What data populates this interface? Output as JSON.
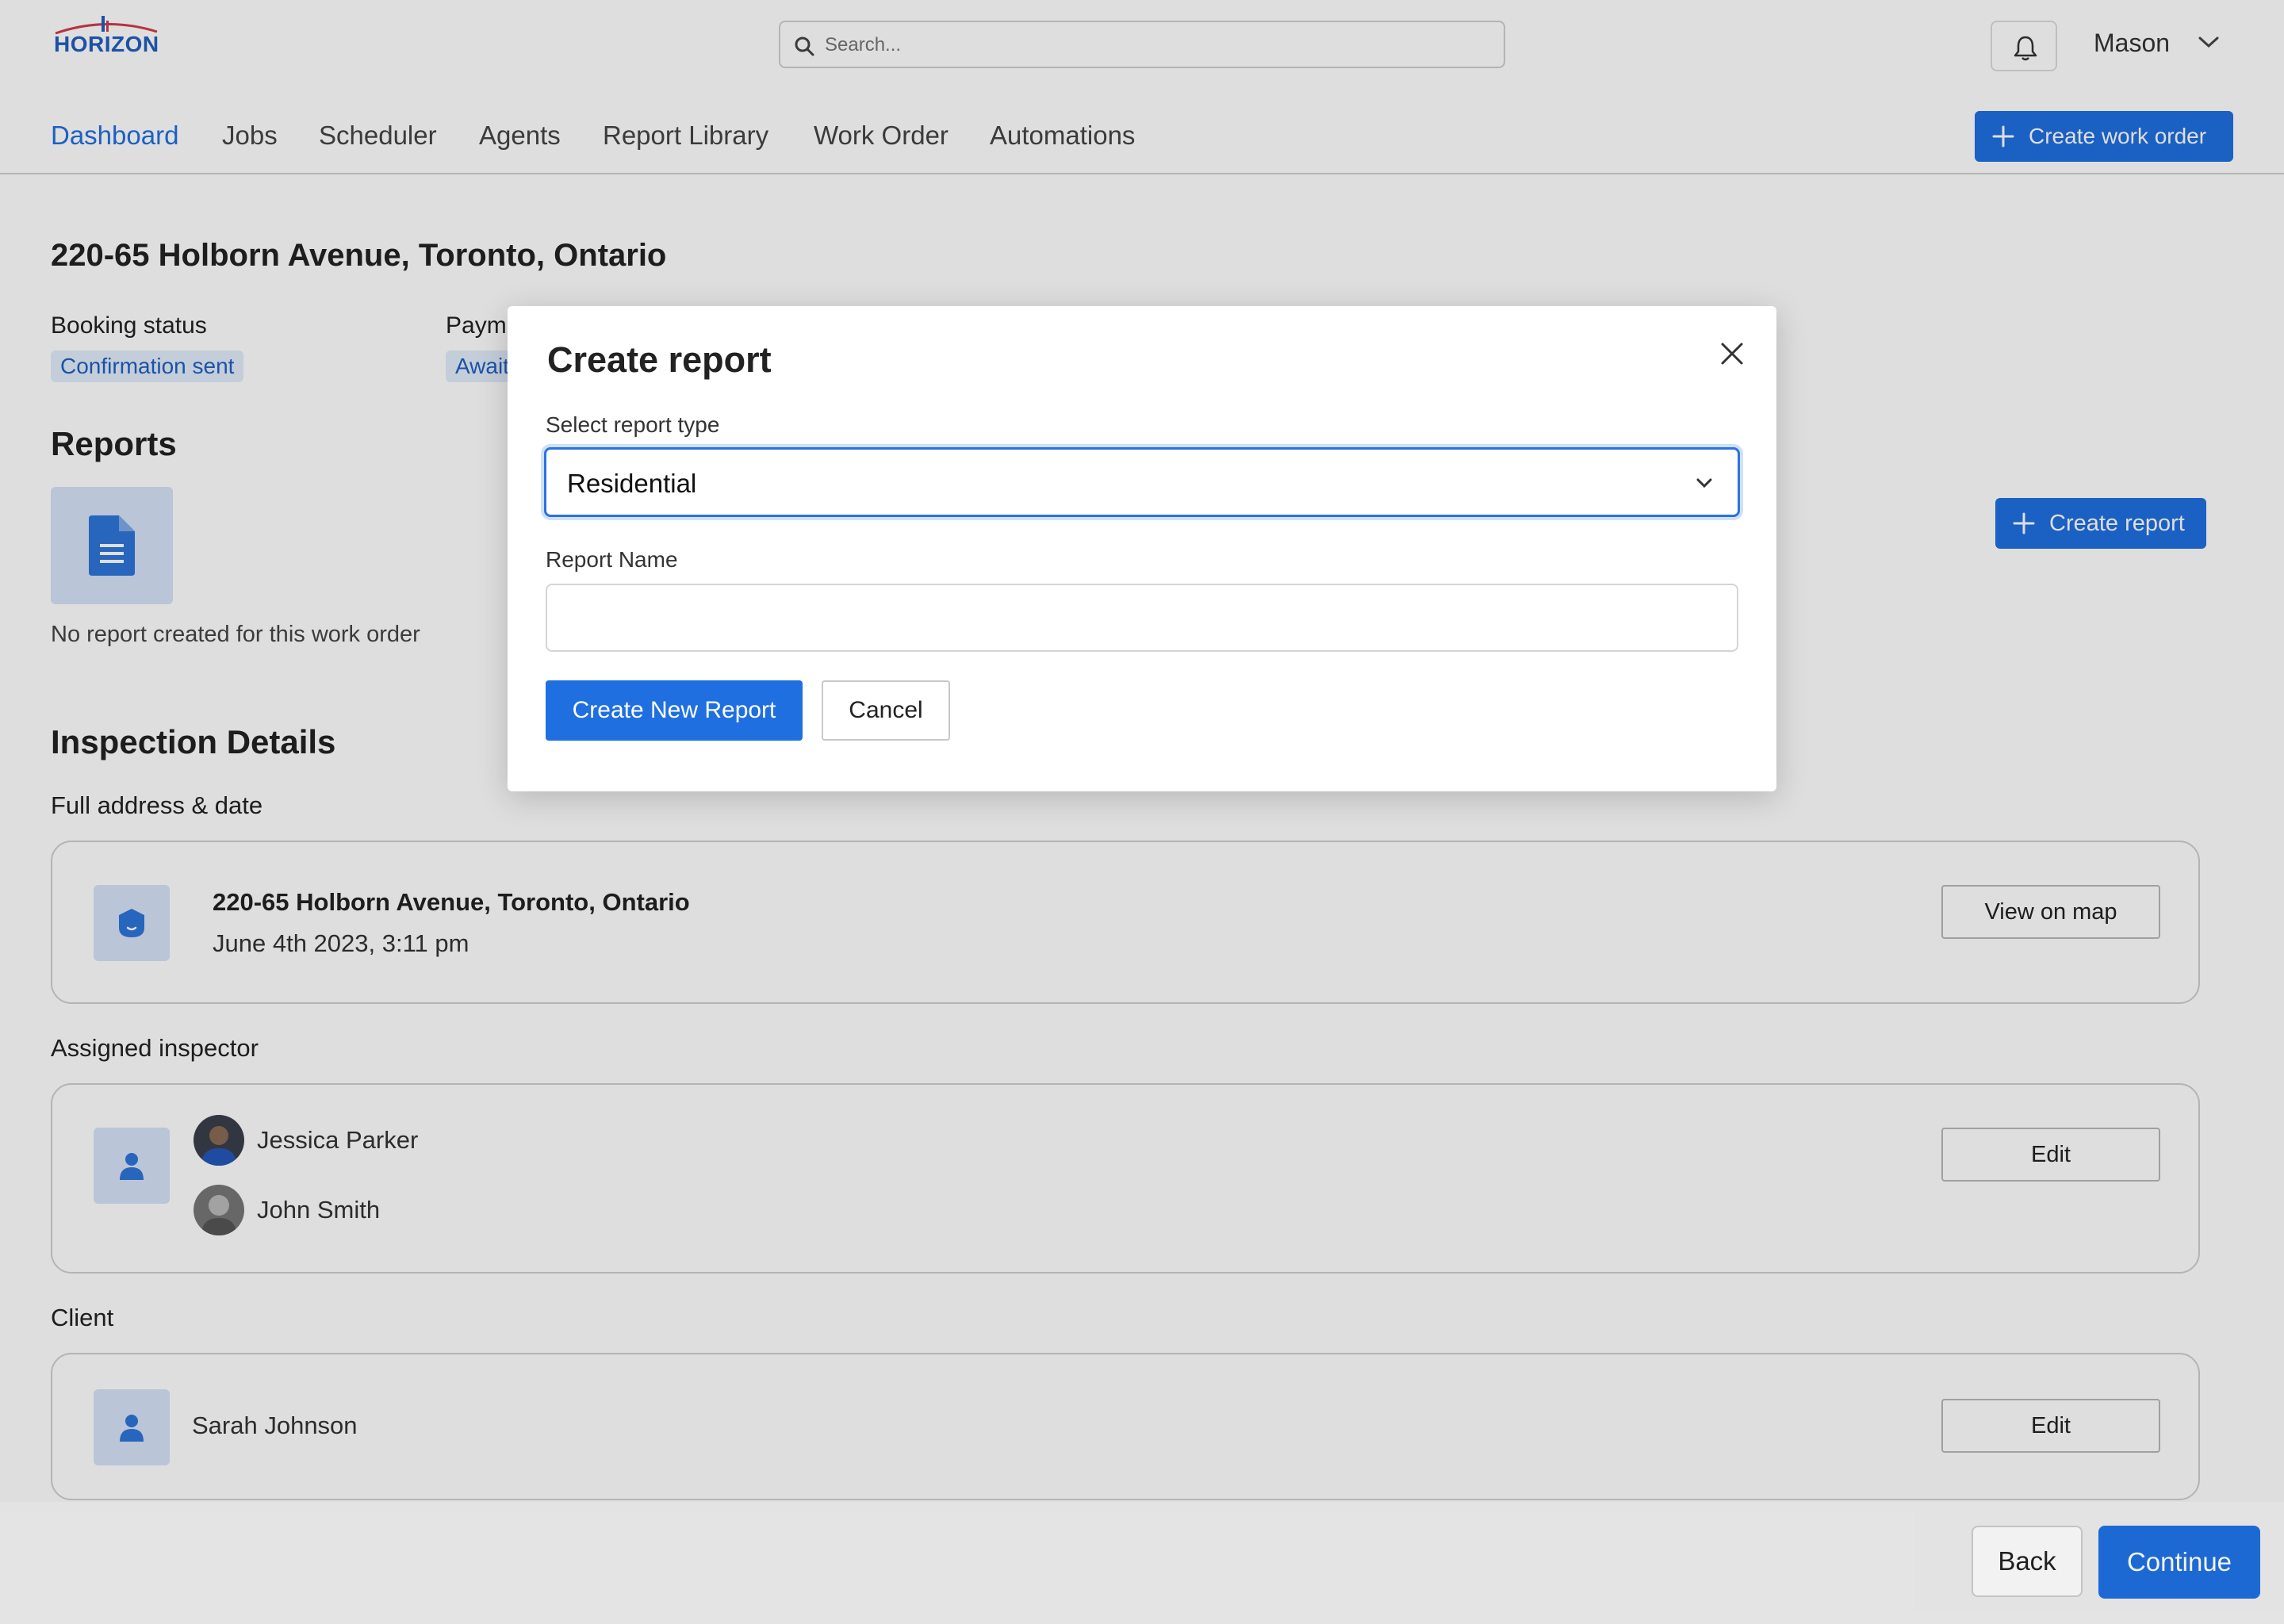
{
  "header": {
    "logo_text": "HORIZON",
    "search_placeholder": "Search...",
    "user_name": "Mason"
  },
  "nav": {
    "items": [
      "Dashboard",
      "Jobs",
      "Scheduler",
      "Agents",
      "Report Library",
      "Work Order",
      "Automations"
    ],
    "active": "Dashboard",
    "create_work_order": "Create work order"
  },
  "main": {
    "address_title": "220-65 Holborn Avenue, Toronto, Ontario",
    "booking_status_label": "Booking status",
    "booking_status_value": "Confirmation sent",
    "payment_label": "Paym",
    "payment_value": "Await",
    "reports_title": "Reports",
    "no_report_text": "No report created for this work order",
    "create_report_button": "Create report",
    "inspection_title": "Inspection Details",
    "full_address_label": "Full address & date",
    "address_card": {
      "address": "220-65 Holborn Avenue, Toronto, Ontario",
      "datetime": "June 4th 2023, 3:11 pm",
      "button": "View on map"
    },
    "assigned_inspector_label": "Assigned inspector",
    "inspectors": [
      "Jessica Parker",
      "John Smith"
    ],
    "inspector_edit": "Edit",
    "client_label": "Client",
    "client_name": "Sarah Johnson",
    "client_edit": "Edit"
  },
  "footer": {
    "back": "Back",
    "continue": "Continue"
  },
  "modal": {
    "title": "Create report",
    "select_label": "Select report type",
    "select_value": "Residential",
    "name_label": "Report Name",
    "name_value": "",
    "create_button": "Create New Report",
    "cancel_button": "Cancel"
  },
  "colors": {
    "accent": "#1f6fe0",
    "tile_bg": "#d6e3f8",
    "badge_text": "#1f5fbf"
  }
}
